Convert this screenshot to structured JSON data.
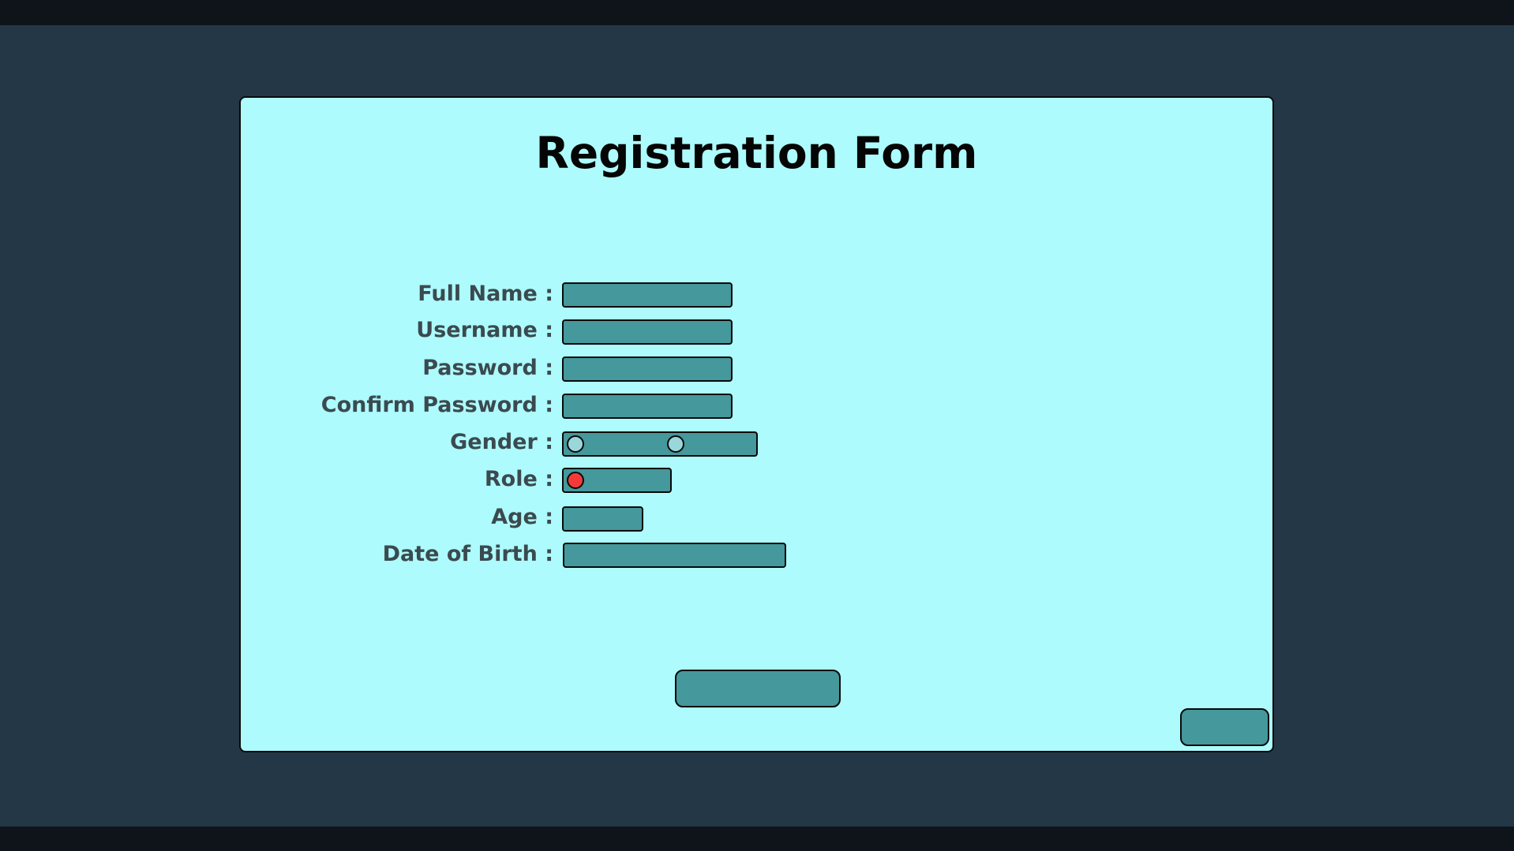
{
  "form": {
    "title": "Registration Form",
    "fields": {
      "full_name": {
        "label": "Full Name :"
      },
      "username": {
        "label": "Username :"
      },
      "password": {
        "label": "Password :"
      },
      "confirm_password": {
        "label": "Confirm Password :"
      },
      "gender": {
        "label": "Gender :"
      },
      "role": {
        "label": "Role :"
      },
      "age": {
        "label": "Age :"
      },
      "date_of_birth": {
        "label": "Date of Birth :"
      }
    }
  },
  "colors": {
    "background": "#243746",
    "letterbox": "#0e1419",
    "panel": "#adfbfd",
    "field": "#45989b",
    "radio_unselected": "#9ad7db",
    "radio_selected": "#f33a3a",
    "label_text": "#3b4a4f"
  }
}
